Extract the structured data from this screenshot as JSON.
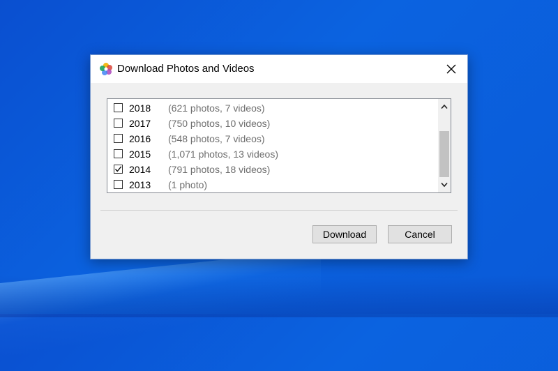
{
  "dialog": {
    "title": "Download Photos and Videos",
    "app_icon": "photos-app-icon",
    "close_icon": "close-icon"
  },
  "list": {
    "items": [
      {
        "year": "2018",
        "count": "(621 photos, 7 videos)",
        "checked": false
      },
      {
        "year": "2017",
        "count": "(750 photos, 10 videos)",
        "checked": false
      },
      {
        "year": "2016",
        "count": "(548 photos, 7 videos)",
        "checked": false
      },
      {
        "year": "2015",
        "count": "(1,071 photos, 13 videos)",
        "checked": false
      },
      {
        "year": "2014",
        "count": "(791 photos, 18 videos)",
        "checked": true
      },
      {
        "year": "2013",
        "count": "(1 photo)",
        "checked": false
      }
    ]
  },
  "buttons": {
    "download_label": "Download",
    "cancel_label": "Cancel"
  }
}
